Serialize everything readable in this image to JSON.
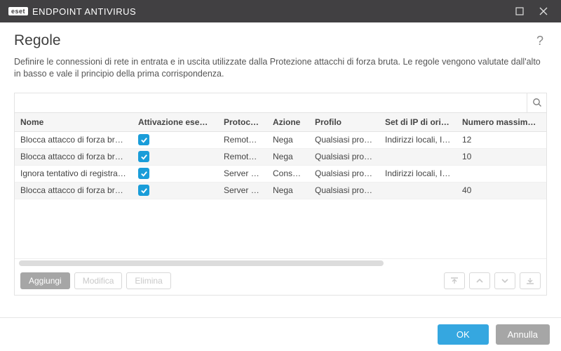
{
  "titlebar": {
    "brand_logo": "eset",
    "brand_product": "ENDPOINT ANTIVIRUS"
  },
  "page": {
    "heading": "Regole",
    "help_glyph": "?",
    "description": "Definire le connessioni di rete in entrata e in uscita utilizzate dalla Protezione attacchi di forza bruta. Le regole vengono valutate dall'alto in basso e vale il principio della prima corrispondenza."
  },
  "search": {
    "placeholder": ""
  },
  "columns": {
    "nome": "Nome",
    "attivazione": "Attivazione eseguita",
    "protocollo": "Protocollo",
    "azione": "Azione",
    "profilo": "Profilo",
    "ip_origine": "Set di IP di origine",
    "max_tentativi": "Numero massimo di t"
  },
  "rows": [
    {
      "nome": "Blocca attacco di forza bruta...",
      "attivazione": true,
      "protocollo": "Remote ...",
      "azione": "Nega",
      "profilo": "Qualsiasi profilo",
      "ip_origine": "Indirizzi locali, In...",
      "max": "12"
    },
    {
      "nome": "Blocca attacco di forza bruta...",
      "attivazione": true,
      "protocollo": "Remote ...",
      "azione": "Nega",
      "profilo": "Qualsiasi profilo",
      "ip_origine": "",
      "max": "10"
    },
    {
      "nome": "Ignora tentativo di registrazi...",
      "attivazione": true,
      "protocollo": "Server M...",
      "azione": "Consenti",
      "profilo": "Qualsiasi profilo",
      "ip_origine": "Indirizzi locali, In...",
      "max": ""
    },
    {
      "nome": "Blocca attacco di forza bruta...",
      "attivazione": true,
      "protocollo": "Server M...",
      "azione": "Nega",
      "profilo": "Qualsiasi profilo",
      "ip_origine": "",
      "max": "40"
    }
  ],
  "toolbar": {
    "add": "Aggiungi",
    "edit": "Modifica",
    "delete": "Elimina"
  },
  "footer": {
    "ok": "OK",
    "cancel": "Annulla"
  },
  "colors": {
    "accent": "#1a9dd9",
    "ok_button": "#35a7e0",
    "grey_button": "#a6a6a6"
  }
}
